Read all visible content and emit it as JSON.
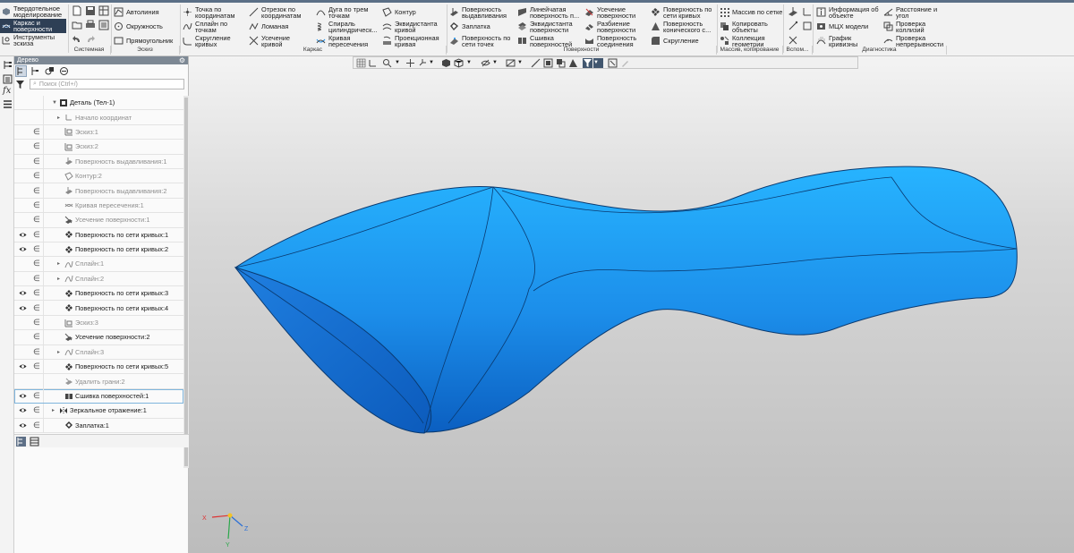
{
  "ribbon": {
    "modes": [
      {
        "label": "Твердотельное моделирование",
        "icon": "solid-modeling-icon",
        "active": false
      },
      {
        "label": "Каркас и поверхности",
        "icon": "surface-modeling-icon",
        "active": true
      },
      {
        "label": "Инструменты эскиза",
        "icon": "sketch-tools-icon",
        "active": false
      }
    ],
    "sketch_tools": {
      "autoline": "Автолиния",
      "circle": "Окружность",
      "rectangle": "Прямоугольник"
    },
    "frame_tools": {
      "point_by_coords": "Точка по\nкоординатам",
      "spline_by_points": "Сплайн по\nточкам",
      "curve_fillet": "Скругление\nкривых",
      "segment_by_coords": "Отрезок по\nкоординатам",
      "polyline": "Ломаная",
      "trim_curve": "Усечение\nкривой",
      "arc_three_points": "Дуга по трем\nточкам",
      "cylindrical_spiral": "Спираль\nцилиндрическ...",
      "intersection_curve": "Кривая\nпересечения",
      "contour": "Контур",
      "equidistant_curve": "Эквидистанта\nкривой",
      "projection_curve": "Проекционная\nкривая"
    },
    "surface_tools": {
      "extrude_surface": "Поверхность\nвыдавливания",
      "patch": "Заплатка",
      "surface_by_points": "Поверхность по\nсети точек",
      "linear_surface": "Линейчатая\nповерхность п...",
      "equidistant_surface": "Эквидистанта\nповерхности",
      "stitch_surfaces": "Сшивка\nповерхностей",
      "trim_surface": "Усечение\nповерхности",
      "split_surface": "Разбиение\nповерхности",
      "join_surface": "Поверхность\nсоединения",
      "surface_by_curves": "Поверхность по\nсети кривых",
      "conic_surface": "Поверхность\nконического с...",
      "fillet": "Скругление"
    },
    "array_tools": {
      "grid_array": "Массив по сетке",
      "copy_objects": "Копировать\nобъекты",
      "geometry_collection": "Коллекция\nгеометрии"
    },
    "diagnostics_tools": {
      "object_info": "Информация об\nобъекте",
      "mass_properties": "МЦХ модели",
      "curvature_graph": "График\nкривизны",
      "distance_angle": "Расстояние и\nугол",
      "collision_check": "Проверка\nколлизий",
      "continuity_check": "Проверка\nнепрерывности"
    },
    "groups": [
      "Системная",
      "Эскиз",
      "Каркас",
      "Поверхности",
      "Массив, копирование",
      "Вспом...",
      "Диагностика"
    ]
  },
  "tree": {
    "title": "Дерево",
    "search_placeholder": "Поиск (Ctrl+/)",
    "rows": [
      {
        "label": "Деталь (Тел-1)",
        "icon": "part-icon",
        "eye": false,
        "counter": false,
        "indent": 1,
        "arrow": "▼",
        "gray": false
      },
      {
        "label": "Начало координат",
        "icon": "origin-icon",
        "eye": false,
        "counter": false,
        "indent": 2,
        "arrow": "▸",
        "gray": true
      },
      {
        "label": "Эскиз:1",
        "icon": "sketch-icon",
        "eye": false,
        "counter": true,
        "indent": 2,
        "arrow": "",
        "gray": true
      },
      {
        "label": "Эскиз:2",
        "icon": "sketch-icon",
        "eye": false,
        "counter": true,
        "indent": 2,
        "arrow": "",
        "gray": true
      },
      {
        "label": "Поверхность выдавливания:1",
        "icon": "extrude-surface-icon",
        "eye": false,
        "counter": true,
        "indent": 2,
        "arrow": "",
        "gray": true
      },
      {
        "label": "Контур:2",
        "icon": "contour-icon",
        "eye": false,
        "counter": true,
        "indent": 2,
        "arrow": "",
        "gray": true
      },
      {
        "label": "Поверхность выдавливания:2",
        "icon": "extrude-surface-icon",
        "eye": false,
        "counter": true,
        "indent": 2,
        "arrow": "",
        "gray": true
      },
      {
        "label": "Кривая пересечения:1",
        "icon": "intersection-curve-icon",
        "eye": false,
        "counter": true,
        "indent": 2,
        "arrow": "",
        "gray": true
      },
      {
        "label": "Усечение поверхности:1",
        "icon": "trim-surface-icon",
        "eye": false,
        "counter": true,
        "indent": 2,
        "arrow": "",
        "gray": true
      },
      {
        "label": "Поверхность по сети кривых:1",
        "icon": "curve-mesh-surface-icon",
        "eye": true,
        "counter": true,
        "indent": 2,
        "arrow": "",
        "gray": false
      },
      {
        "label": "Поверхность по сети кривых:2",
        "icon": "curve-mesh-surface-icon",
        "eye": true,
        "counter": true,
        "indent": 2,
        "arrow": "",
        "gray": false
      },
      {
        "label": "Сплайн:1",
        "icon": "spline-icon",
        "eye": false,
        "counter": true,
        "indent": 2,
        "arrow": "▸",
        "gray": true
      },
      {
        "label": "Сплайн:2",
        "icon": "spline-icon",
        "eye": false,
        "counter": true,
        "indent": 2,
        "arrow": "▸",
        "gray": true
      },
      {
        "label": "Поверхность по сети кривых:3",
        "icon": "curve-mesh-surface-icon",
        "eye": true,
        "counter": true,
        "indent": 2,
        "arrow": "",
        "gray": false
      },
      {
        "label": "Поверхность по сети кривых:4",
        "icon": "curve-mesh-surface-icon",
        "eye": true,
        "counter": true,
        "indent": 2,
        "arrow": "",
        "gray": false
      },
      {
        "label": "Эскиз:3",
        "icon": "sketch-icon",
        "eye": false,
        "counter": true,
        "indent": 2,
        "arrow": "",
        "gray": true
      },
      {
        "label": "Усечение поверхности:2",
        "icon": "trim-surface-icon",
        "eye": false,
        "counter": true,
        "indent": 2,
        "arrow": "",
        "gray": false
      },
      {
        "label": "Сплайн:3",
        "icon": "spline-icon",
        "eye": false,
        "counter": true,
        "indent": 2,
        "arrow": "▸",
        "gray": true
      },
      {
        "label": "Поверхность по сети кривых:5",
        "icon": "curve-mesh-surface-icon",
        "eye": true,
        "counter": true,
        "indent": 2,
        "arrow": "",
        "gray": false
      },
      {
        "label": "Удалить грани:2",
        "icon": "delete-faces-icon",
        "eye": false,
        "counter": false,
        "indent": 2,
        "arrow": "",
        "gray": true
      },
      {
        "label": "Сшивка поверхностей:1",
        "icon": "stitch-icon",
        "eye": true,
        "counter": true,
        "indent": 2,
        "arrow": "",
        "gray": false,
        "selected": true
      },
      {
        "label": "Зеркальное отражение:1",
        "icon": "mirror-icon",
        "eye": true,
        "counter": true,
        "indent": 1,
        "arrow": "▸",
        "gray": false
      },
      {
        "label": "Заплатка:1",
        "icon": "patch-icon",
        "eye": true,
        "counter": true,
        "indent": 2,
        "arrow": "",
        "gray": false
      }
    ]
  },
  "viewport": {
    "model_color": "#1c8eea",
    "triad_labels": {
      "x": "X",
      "y": "Y",
      "z": "Z"
    }
  },
  "colors": {
    "active_mode": "#2e3f55",
    "tree_header": "#7d8894",
    "selection": "#7fb5dd"
  }
}
